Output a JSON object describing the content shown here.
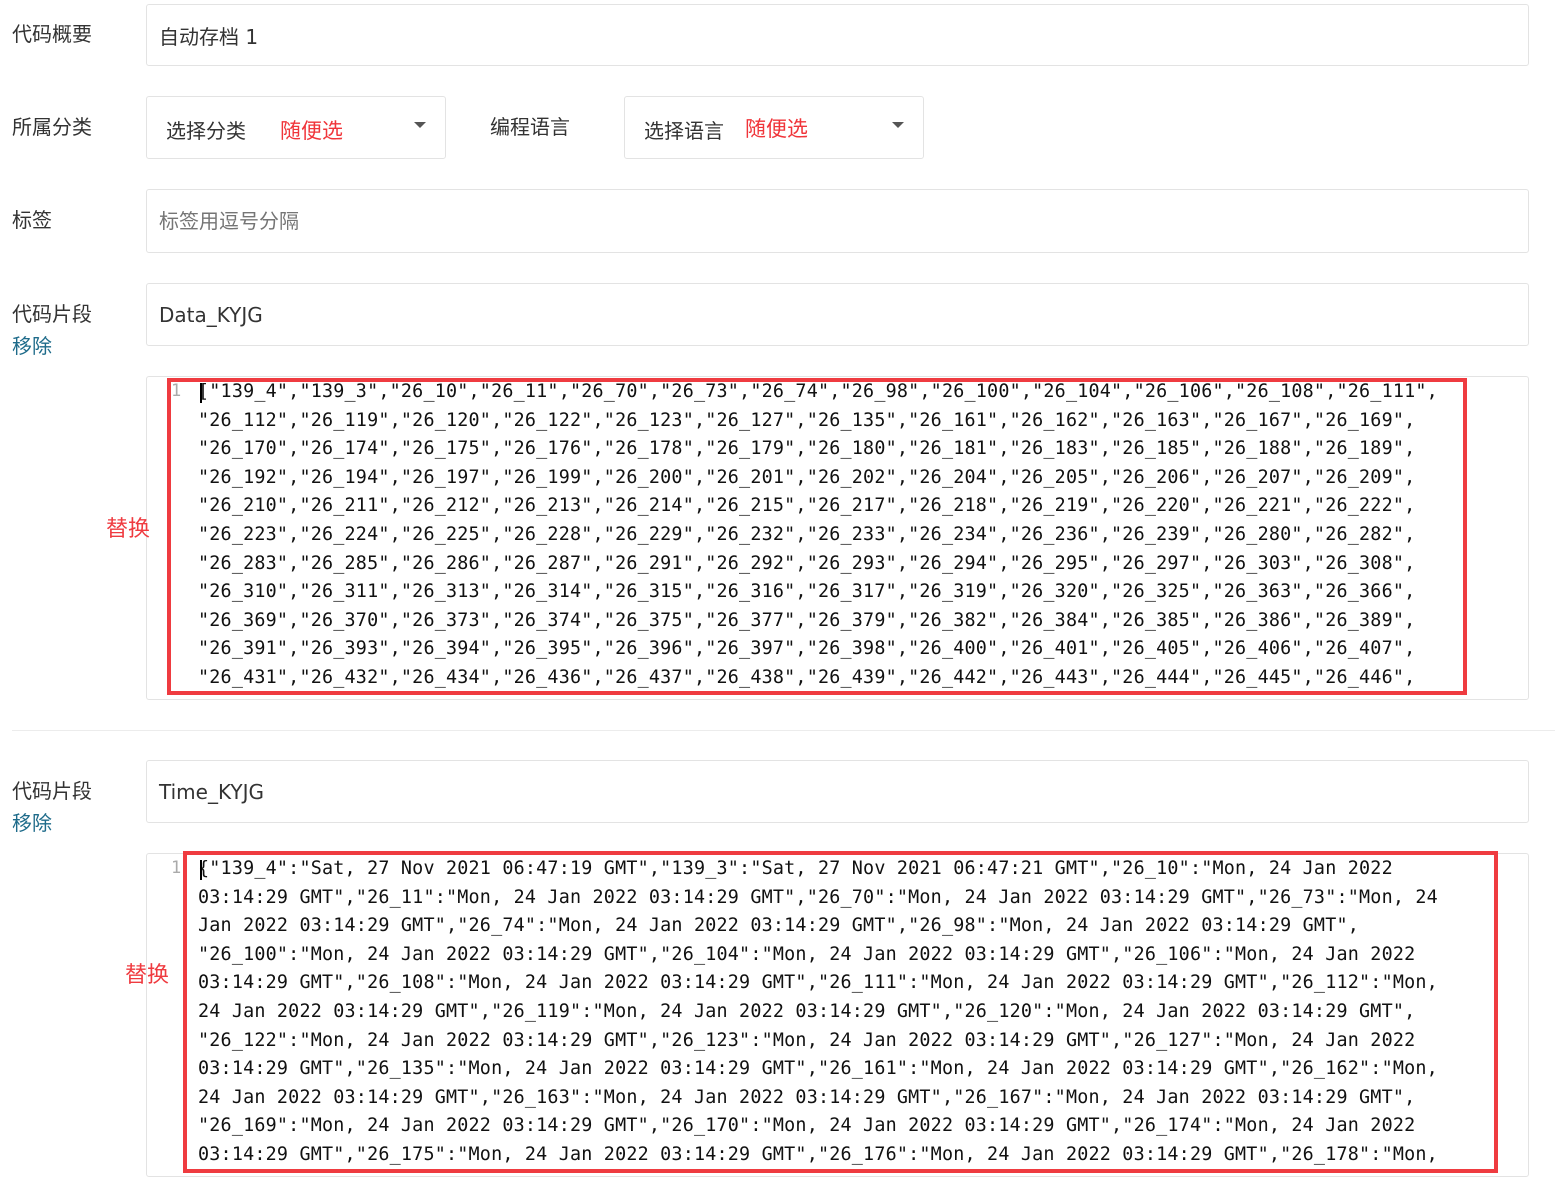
{
  "summary": {
    "label": "代码概要",
    "value": "自动存档 1"
  },
  "category": {
    "label": "所属分类",
    "select_text": "选择分类",
    "annotation": "随便选"
  },
  "language": {
    "label": "编程语言",
    "select_text": "选择语言",
    "annotation": "随便选"
  },
  "tags": {
    "label": "标签",
    "placeholder": "标签用逗号分隔"
  },
  "snippets": [
    {
      "label": "代码片段",
      "remove": "移除",
      "name": "Data_KYJG",
      "replace_annotation": "替换",
      "line_number": "1",
      "code_lines": [
        "[\"139_4\",\"139_3\",\"26_10\",\"26_11\",\"26_70\",\"26_73\",\"26_74\",\"26_98\",\"26_100\",\"26_104\",\"26_106\",\"26_108\",\"26_111\",",
        "\"26_112\",\"26_119\",\"26_120\",\"26_122\",\"26_123\",\"26_127\",\"26_135\",\"26_161\",\"26_162\",\"26_163\",\"26_167\",\"26_169\",",
        "\"26_170\",\"26_174\",\"26_175\",\"26_176\",\"26_178\",\"26_179\",\"26_180\",\"26_181\",\"26_183\",\"26_185\",\"26_188\",\"26_189\",",
        "\"26_192\",\"26_194\",\"26_197\",\"26_199\",\"26_200\",\"26_201\",\"26_202\",\"26_204\",\"26_205\",\"26_206\",\"26_207\",\"26_209\",",
        "\"26_210\",\"26_211\",\"26_212\",\"26_213\",\"26_214\",\"26_215\",\"26_217\",\"26_218\",\"26_219\",\"26_220\",\"26_221\",\"26_222\",",
        "\"26_223\",\"26_224\",\"26_225\",\"26_228\",\"26_229\",\"26_232\",\"26_233\",\"26_234\",\"26_236\",\"26_239\",\"26_280\",\"26_282\",",
        "\"26_283\",\"26_285\",\"26_286\",\"26_287\",\"26_291\",\"26_292\",\"26_293\",\"26_294\",\"26_295\",\"26_297\",\"26_303\",\"26_308\",",
        "\"26_310\",\"26_311\",\"26_313\",\"26_314\",\"26_315\",\"26_316\",\"26_317\",\"26_319\",\"26_320\",\"26_325\",\"26_363\",\"26_366\",",
        "\"26_369\",\"26_370\",\"26_373\",\"26_374\",\"26_375\",\"26_377\",\"26_379\",\"26_382\",\"26_384\",\"26_385\",\"26_386\",\"26_389\",",
        "\"26_391\",\"26_393\",\"26_394\",\"26_395\",\"26_396\",\"26_397\",\"26_398\",\"26_400\",\"26_401\",\"26_405\",\"26_406\",\"26_407\",",
        "\"26_431\",\"26_432\",\"26_434\",\"26_436\",\"26_437\",\"26_438\",\"26_439\",\"26_442\",\"26_443\",\"26_444\",\"26_445\",\"26_446\","
      ]
    },
    {
      "label": "代码片段",
      "remove": "移除",
      "name": "Time_KYJG",
      "replace_annotation": "替换",
      "line_number": "1",
      "code_lines": [
        "{\"139_4\":\"Sat, 27 Nov 2021 06:47:19 GMT\",\"139_3\":\"Sat, 27 Nov 2021 06:47:21 GMT\",\"26_10\":\"Mon, 24 Jan 2022",
        "03:14:29 GMT\",\"26_11\":\"Mon, 24 Jan 2022 03:14:29 GMT\",\"26_70\":\"Mon, 24 Jan 2022 03:14:29 GMT\",\"26_73\":\"Mon, 24",
        "Jan 2022 03:14:29 GMT\",\"26_74\":\"Mon, 24 Jan 2022 03:14:29 GMT\",\"26_98\":\"Mon, 24 Jan 2022 03:14:29 GMT\",",
        "\"26_100\":\"Mon, 24 Jan 2022 03:14:29 GMT\",\"26_104\":\"Mon, 24 Jan 2022 03:14:29 GMT\",\"26_106\":\"Mon, 24 Jan 2022",
        "03:14:29 GMT\",\"26_108\":\"Mon, 24 Jan 2022 03:14:29 GMT\",\"26_111\":\"Mon, 24 Jan 2022 03:14:29 GMT\",\"26_112\":\"Mon,",
        "24 Jan 2022 03:14:29 GMT\",\"26_119\":\"Mon, 24 Jan 2022 03:14:29 GMT\",\"26_120\":\"Mon, 24 Jan 2022 03:14:29 GMT\",",
        "\"26_122\":\"Mon, 24 Jan 2022 03:14:29 GMT\",\"26_123\":\"Mon, 24 Jan 2022 03:14:29 GMT\",\"26_127\":\"Mon, 24 Jan 2022",
        "03:14:29 GMT\",\"26_135\":\"Mon, 24 Jan 2022 03:14:29 GMT\",\"26_161\":\"Mon, 24 Jan 2022 03:14:29 GMT\",\"26_162\":\"Mon,",
        "24 Jan 2022 03:14:29 GMT\",\"26_163\":\"Mon, 24 Jan 2022 03:14:29 GMT\",\"26_167\":\"Mon, 24 Jan 2022 03:14:29 GMT\",",
        "\"26_169\":\"Mon, 24 Jan 2022 03:14:29 GMT\",\"26_170\":\"Mon, 24 Jan 2022 03:14:29 GMT\",\"26_174\":\"Mon, 24 Jan 2022",
        "03:14:29 GMT\",\"26_175\":\"Mon, 24 Jan 2022 03:14:29 GMT\",\"26_176\":\"Mon, 24 Jan 2022 03:14:29 GMT\",\"26_178\":\"Mon,"
      ]
    }
  ]
}
